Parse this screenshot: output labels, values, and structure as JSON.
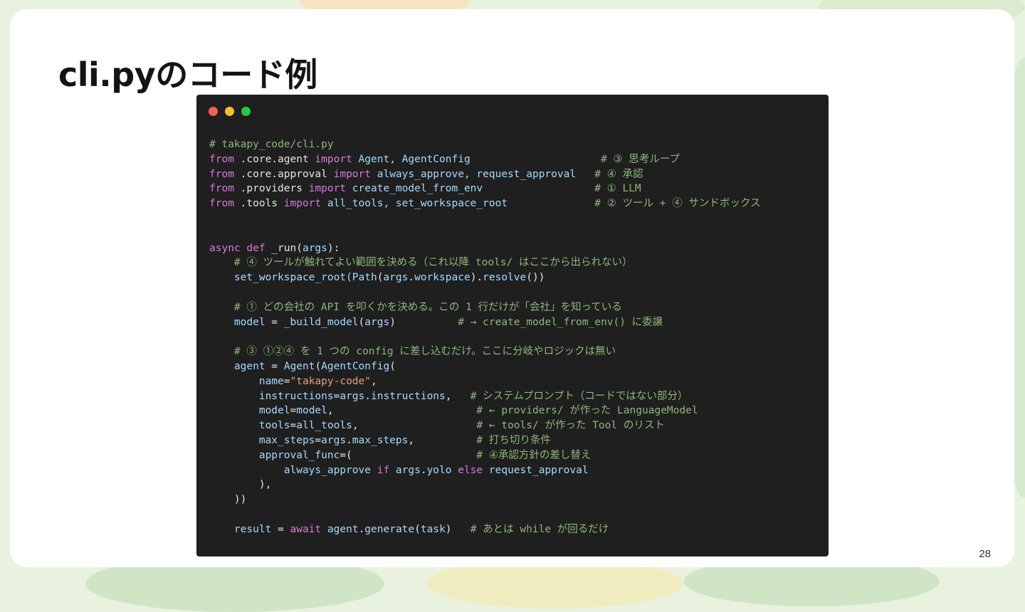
{
  "slide": {
    "title": "cli.pyのコード例",
    "page_number": "28"
  },
  "code_window": {
    "traffic_lights": [
      "#ff5f57",
      "#febc2e",
      "#28c840"
    ],
    "lines": [
      [
        {
          "t": "# takapy_code/cli.py",
          "k": "comment"
        }
      ],
      [
        {
          "t": "from",
          "k": "keyword"
        },
        {
          "t": " .core.agent ",
          "k": "plain"
        },
        {
          "t": "import",
          "k": "keyword"
        },
        {
          "t": " Agent, AgentConfig",
          "k": "name"
        },
        {
          "t": "                     # ③ 思考ループ",
          "k": "comment"
        }
      ],
      [
        {
          "t": "from",
          "k": "keyword"
        },
        {
          "t": " .core.approval ",
          "k": "plain"
        },
        {
          "t": "import",
          "k": "keyword"
        },
        {
          "t": " always_approve, request_approval",
          "k": "name"
        },
        {
          "t": "   # ④ 承認",
          "k": "comment"
        }
      ],
      [
        {
          "t": "from",
          "k": "keyword"
        },
        {
          "t": " .providers ",
          "k": "plain"
        },
        {
          "t": "import",
          "k": "keyword"
        },
        {
          "t": " create_model_from_env",
          "k": "name"
        },
        {
          "t": "                  # ① LLM",
          "k": "comment"
        }
      ],
      [
        {
          "t": "from",
          "k": "keyword"
        },
        {
          "t": " .tools ",
          "k": "plain"
        },
        {
          "t": "import",
          "k": "keyword"
        },
        {
          "t": " all_tools, set_workspace_root",
          "k": "name"
        },
        {
          "t": "              # ② ツール + ④ サンドボックス",
          "k": "comment"
        }
      ],
      [],
      [],
      [
        {
          "t": "async def",
          "k": "keyword"
        },
        {
          "t": " _run(",
          "k": "plain"
        },
        {
          "t": "args",
          "k": "name"
        },
        {
          "t": "):",
          "k": "plain"
        }
      ],
      [
        {
          "t": "    # ④ ツールが触れてよい範囲を決める（これ以降 tools/ はここから出られない）",
          "k": "comment"
        }
      ],
      [
        {
          "t": "    set_workspace_root(",
          "k": "name"
        },
        {
          "t": "Path",
          "k": "name"
        },
        {
          "t": "(",
          "k": "plain"
        },
        {
          "t": "args",
          "k": "name"
        },
        {
          "t": ".",
          "k": "plain"
        },
        {
          "t": "workspace",
          "k": "name"
        },
        {
          "t": ").",
          "k": "plain"
        },
        {
          "t": "resolve",
          "k": "name"
        },
        {
          "t": "())",
          "k": "plain"
        }
      ],
      [],
      [
        {
          "t": "    # ① どの会社の API を叩くかを決める。この 1 行だけが「会社」を知っている",
          "k": "comment"
        }
      ],
      [
        {
          "t": "    model",
          "k": "name"
        },
        {
          "t": " = ",
          "k": "plain"
        },
        {
          "t": "_build_model",
          "k": "name"
        },
        {
          "t": "(",
          "k": "plain"
        },
        {
          "t": "args",
          "k": "name"
        },
        {
          "t": ")",
          "k": "plain"
        },
        {
          "t": "          # → create_model_from_env() に委譲",
          "k": "comment"
        }
      ],
      [],
      [
        {
          "t": "    # ③ ①②④ を 1 つの config に差し込むだけ。ここに分岐やロジックは無い",
          "k": "comment"
        }
      ],
      [
        {
          "t": "    agent",
          "k": "name"
        },
        {
          "t": " = ",
          "k": "plain"
        },
        {
          "t": "Agent",
          "k": "name"
        },
        {
          "t": "(",
          "k": "plain"
        },
        {
          "t": "AgentConfig",
          "k": "name"
        },
        {
          "t": "(",
          "k": "plain"
        }
      ],
      [
        {
          "t": "        name",
          "k": "name"
        },
        {
          "t": "=",
          "k": "plain"
        },
        {
          "t": "\"takapy-code\"",
          "k": "string"
        },
        {
          "t": ",",
          "k": "plain"
        }
      ],
      [
        {
          "t": "        instructions",
          "k": "name"
        },
        {
          "t": "=",
          "k": "plain"
        },
        {
          "t": "args",
          "k": "name"
        },
        {
          "t": ".",
          "k": "plain"
        },
        {
          "t": "instructions",
          "k": "name"
        },
        {
          "t": ",",
          "k": "plain"
        },
        {
          "t": "   # システムプロンプト（コードではない部分）",
          "k": "comment"
        }
      ],
      [
        {
          "t": "        model",
          "k": "name"
        },
        {
          "t": "=",
          "k": "plain"
        },
        {
          "t": "model",
          "k": "name"
        },
        {
          "t": ",",
          "k": "plain"
        },
        {
          "t": "                       # ← providers/ が作った LanguageModel",
          "k": "comment"
        }
      ],
      [
        {
          "t": "        tools",
          "k": "name"
        },
        {
          "t": "=",
          "k": "plain"
        },
        {
          "t": "all_tools",
          "k": "name"
        },
        {
          "t": ",",
          "k": "plain"
        },
        {
          "t": "                   # ← tools/ が作った Tool のリスト",
          "k": "comment"
        }
      ],
      [
        {
          "t": "        max_steps",
          "k": "name"
        },
        {
          "t": "=",
          "k": "plain"
        },
        {
          "t": "args",
          "k": "name"
        },
        {
          "t": ".",
          "k": "plain"
        },
        {
          "t": "max_steps",
          "k": "name"
        },
        {
          "t": ",",
          "k": "plain"
        },
        {
          "t": "          # 打ち切り条件",
          "k": "comment"
        }
      ],
      [
        {
          "t": "        approval_func",
          "k": "name"
        },
        {
          "t": "=(",
          "k": "plain"
        },
        {
          "t": "                    # ④承認方針の差し替え",
          "k": "comment"
        }
      ],
      [
        {
          "t": "            always_approve",
          "k": "name"
        },
        {
          "t": " if ",
          "k": "keyword"
        },
        {
          "t": "args",
          "k": "name"
        },
        {
          "t": ".",
          "k": "plain"
        },
        {
          "t": "yolo",
          "k": "name"
        },
        {
          "t": " else ",
          "k": "keyword"
        },
        {
          "t": "request_approval",
          "k": "name"
        }
      ],
      [
        {
          "t": "        ),",
          "k": "plain"
        }
      ],
      [
        {
          "t": "    ))",
          "k": "plain"
        }
      ],
      [],
      [
        {
          "t": "    result",
          "k": "name"
        },
        {
          "t": " = ",
          "k": "plain"
        },
        {
          "t": "await",
          "k": "keyword"
        },
        {
          "t": " agent",
          "k": "name"
        },
        {
          "t": ".",
          "k": "plain"
        },
        {
          "t": "generate",
          "k": "name"
        },
        {
          "t": "(",
          "k": "plain"
        },
        {
          "t": "task",
          "k": "name"
        },
        {
          "t": ")",
          "k": "plain"
        },
        {
          "t": "   # あとは while が回るだけ",
          "k": "comment"
        }
      ]
    ]
  }
}
